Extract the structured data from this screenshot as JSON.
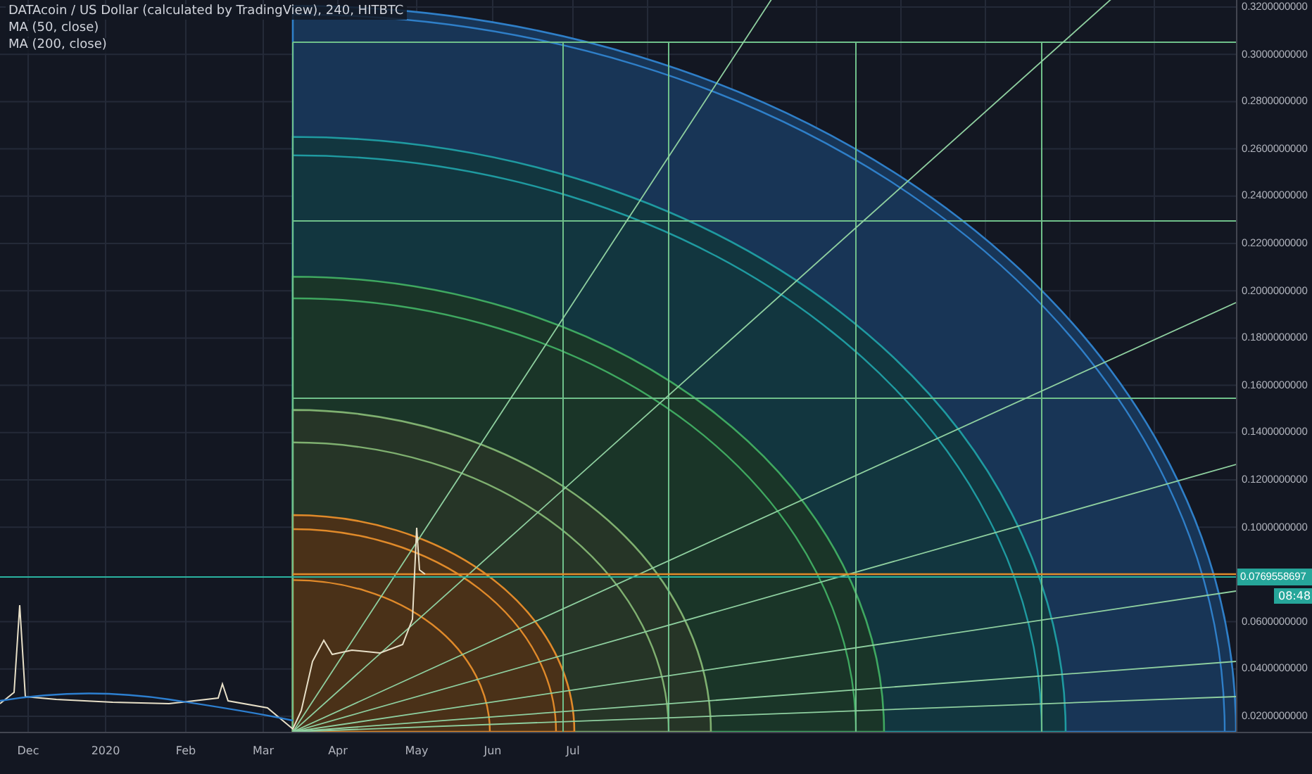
{
  "legend": {
    "title": "DATAcoin / US Dollar (calculated by TradingView), 240, HITBTC",
    "indicators": [
      "MA (50, close)",
      "MA (200, close)"
    ]
  },
  "price_axis": {
    "ticks": [
      "0.3200000000",
      "0.3000000000",
      "0.2800000000",
      "0.2600000000",
      "0.2400000000",
      "0.2200000000",
      "0.2000000000",
      "0.1800000000",
      "0.1600000000",
      "0.1400000000",
      "0.1200000000",
      "0.1000000000",
      "0.0600000000",
      "0.0400000000",
      "0.0200000000"
    ],
    "last_price": "0.0769558697",
    "countdown": "08:48"
  },
  "time_axis": {
    "labels": [
      "Dec",
      "2020",
      "Feb",
      "Mar",
      "Apr",
      "May",
      "Jun",
      "Jul"
    ]
  }
}
